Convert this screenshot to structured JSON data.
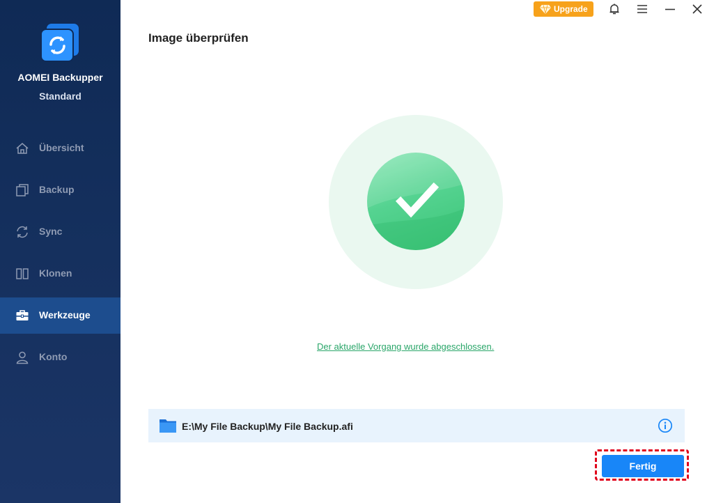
{
  "app": {
    "name": "AOMEI Backupper",
    "edition": "Standard",
    "logo_icon": "sync-logo-icon"
  },
  "sidebar": {
    "items": [
      {
        "label": "Übersicht",
        "icon": "home-icon",
        "active": false
      },
      {
        "label": "Backup",
        "icon": "copy-icon",
        "active": false
      },
      {
        "label": "Sync",
        "icon": "sync-icon",
        "active": false
      },
      {
        "label": "Klonen",
        "icon": "clone-icon",
        "active": false
      },
      {
        "label": "Werkzeuge",
        "icon": "toolbox-icon",
        "active": true
      },
      {
        "label": "Konto",
        "icon": "user-icon",
        "active": false
      }
    ]
  },
  "topbar": {
    "upgrade_label": "Upgrade"
  },
  "main": {
    "title": "Image überprüfen",
    "status_message": "Der aktuelle Vorgang wurde abgeschlossen.",
    "file_path": "E:\\My File Backup\\My File Backup.afi",
    "finish_label": "Fertig"
  },
  "colors": {
    "sidebar_bg": "#132e5b",
    "sidebar_active": "#1d4d8e",
    "accent_blue": "#1886f8",
    "success_green": "#3bc476",
    "upgrade_orange": "#f7a21b",
    "highlight_red": "#e0001a"
  }
}
